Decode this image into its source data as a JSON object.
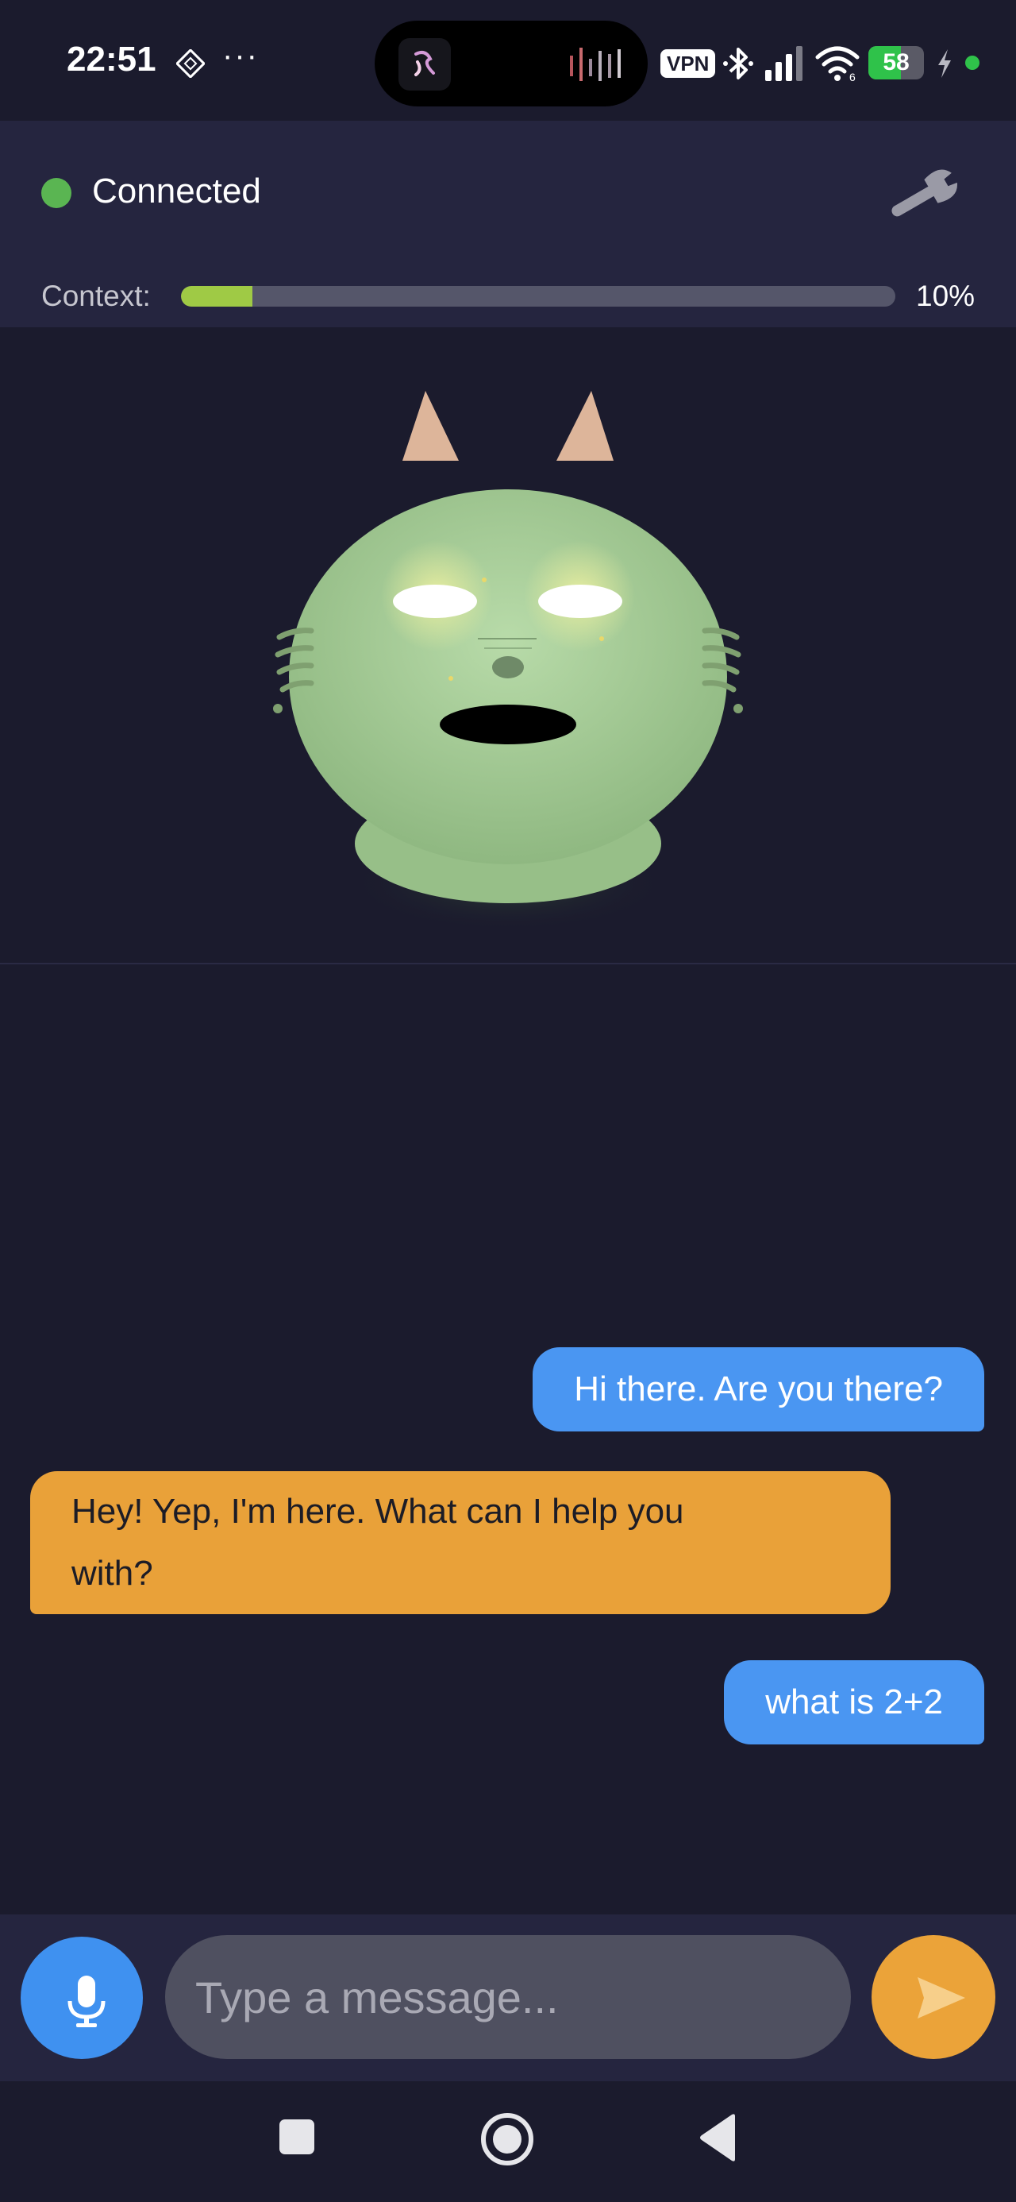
{
  "status_bar": {
    "time": "22:51",
    "dots": "···",
    "vpn": "VPN",
    "battery": "58",
    "battery_fraction": 0.58,
    "icons": [
      "grid-icon",
      "island-app-icon",
      "audio-wave-icon",
      "bluetooth-icon",
      "signal-icon",
      "wifi-icon",
      "battery-icon",
      "charging-icon"
    ]
  },
  "header": {
    "connection_status": "Connected",
    "status_color": "#5ab552",
    "settings_icon": "wrench-icon",
    "context_label": "Context:",
    "context_percent_text": "10%",
    "context_fraction": 0.1
  },
  "avatar": {
    "description_icon": "cat-avatar-icon",
    "body_color": "#a8cf98"
  },
  "messages": [
    {
      "role": "user",
      "text": "Hi there. Are you there?"
    },
    {
      "role": "assistant",
      "lines": [
        "Hey! Yep, I'm here. What can I help you",
        "with?"
      ]
    },
    {
      "role": "user",
      "text": "what is 2+2"
    }
  ],
  "composer": {
    "placeholder": "Type a message...",
    "mic_icon": "microphone-icon",
    "send_icon": "send-icon"
  },
  "navbar": {
    "icons": [
      "recents-square-icon",
      "home-circle-icon",
      "back-triangle-icon"
    ]
  },
  "colors": {
    "background": "#1b1b2d",
    "header": "#25253f",
    "user_bubble": "#4a96f2",
    "assistant_bubble": "#e9a139",
    "accent_green": "#9fca45"
  }
}
